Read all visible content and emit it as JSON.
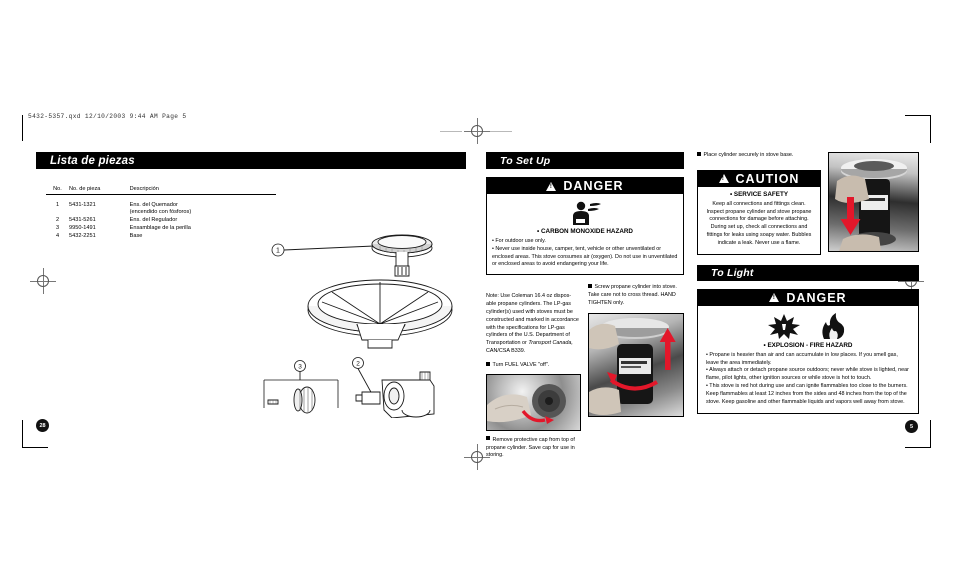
{
  "print_slug": "5432-5357.qxd   12/10/2003   9:44 AM   Page 5",
  "left": {
    "section_title": "Lista de piezas",
    "table": {
      "headers": [
        "No.",
        "No. de pieza",
        "Descripción"
      ],
      "rows": [
        {
          "no": "1",
          "part_no": "5431-1321",
          "desc": "Ens. del Quemador",
          "desc2": "(encendido con fósforos)"
        },
        {
          "no": "2",
          "part_no": "5431-5261",
          "desc": "Ens. del Regulador",
          "desc2": ""
        },
        {
          "no": "3",
          "part_no": "9950-1491",
          "desc": "Ensamblage de la perilla",
          "desc2": ""
        },
        {
          "no": "4",
          "part_no": "5432-2251",
          "desc": "Base",
          "desc2": ""
        }
      ]
    },
    "diagram_callouts": [
      "1",
      "2",
      "3"
    ],
    "page_number": "28"
  },
  "middle": {
    "section_title": "To Set Up",
    "danger": {
      "word": "DANGER",
      "hazard_title": "• CARBON MONOXIDE HAZARD",
      "icon": "carbon-monoxide-person-icon",
      "bullets": [
        "• For outdoor use only.",
        "• Never use inside house, camper, tent, vehicle or other unventilated or enclosed areas. This stove consumes air (oxygen). Do not use in unventilated or enclosed areas to avoid endangering your life."
      ]
    },
    "note": "Note: Use Coleman 16.4 oz dispos-able propane cylinders. The LP-gas cylinder(s) used with stoves must be constructed and marked in accordance with the specifications for LP-gas cylinders of the U.S. Department of Transportation or ",
    "note_italic": "Transport Canada,",
    "note_tail": " CAN/CSA B339.",
    "step_fuel_valve": "Turn FUEL VALVE \"off\".",
    "step_cap": "Remove protective cap from top of propane cylinder. Save cap for use in storing.",
    "step_screw": "Screw propane cylinder into stove. Take care not to cross thread. HAND TIGHTEN only.",
    "photo_cap_alt": "hand-removing-cap-photo",
    "photo_screw_alt": "hand-screwing-cylinder-photo"
  },
  "right": {
    "step_place": "Place cylinder securely in stove base.",
    "photo_place_alt": "hand-placing-cylinder-in-base-photo",
    "caution": {
      "word": "CAUTION",
      "hazard_title": "• SERVICE SAFETY",
      "lines": [
        "Keep all connections and fittings clean.",
        "Inspect propane cylinder and stove propane connections for damage before attaching.",
        "During set up, check all connections and fittings for leaks using soapy water. Bubbles indicate a leak. Never use a flame."
      ]
    },
    "section_title": "To Light",
    "danger": {
      "word": "DANGER",
      "hazard_title": "• EXPLOSION - FIRE HAZARD",
      "icons": [
        "explosion-icon",
        "fire-icon"
      ],
      "bullets": [
        "• Propane is heavier than air and can accumulate in low places. If you smell gas, leave the area immediately.",
        "• Always attach or detach propane source outdoors; never while stove is lighted, near flame, pilot lights, other ignition sources or while stove is hot to touch.",
        "• This stove is red hot during use and can ignite flammables too close to the burners. Keep flammables at least 12 inches from the sides and 48 inches from the top of the stove. Keep gasoline and other flammable liquids and vapors well away from stove."
      ]
    },
    "page_number": "5"
  },
  "colors": {
    "bar": "#000000",
    "paper": "#ffffff",
    "arrow_red": "#e3172a"
  }
}
